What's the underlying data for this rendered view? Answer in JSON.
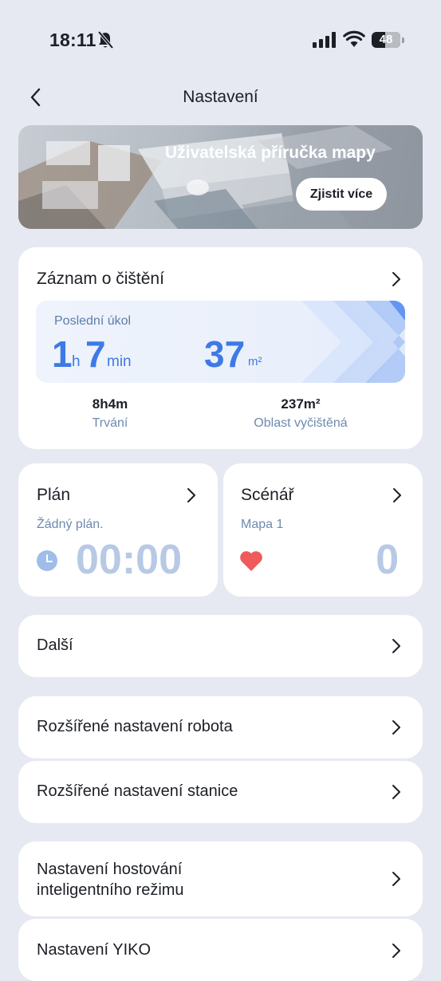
{
  "status_bar": {
    "time": "18:11",
    "battery": "48",
    "battery_level": 0.48
  },
  "header": {
    "title": "Nastavení"
  },
  "banner": {
    "title": "Uživatelská příručka mapy",
    "button": "Zjistit více"
  },
  "cleaning_record": {
    "title": "Záznam o čištění",
    "last_task_label": "Poslední úkol",
    "hours": "1",
    "hours_unit": "h",
    "minutes": "7",
    "minutes_unit": "min",
    "area": "37",
    "area_unit": "m²",
    "duration_value": "8h4m",
    "duration_label": "Trvání",
    "cleaned_area_value": "237m²",
    "cleaned_area_label": "Oblast vyčištěná"
  },
  "plan": {
    "title": "Plán",
    "status": "Žádný plán.",
    "time": "00:00"
  },
  "scenario": {
    "title": "Scénář",
    "map": "Mapa 1",
    "count": "0"
  },
  "menu": {
    "more": "Další",
    "robot_settings": "Rozšířené nastavení robota",
    "station_settings": "Rozšířené nastavení stanice",
    "hosting_line1": "Nastavení hostování",
    "hosting_line2": "inteligentního režimu",
    "yiko": "Nastavení YIKO"
  },
  "colors": {
    "accent": "#3d7ae5",
    "muted": "#b7c9e4",
    "heart": "#ef5a5a",
    "background": "#e6e9f1"
  }
}
